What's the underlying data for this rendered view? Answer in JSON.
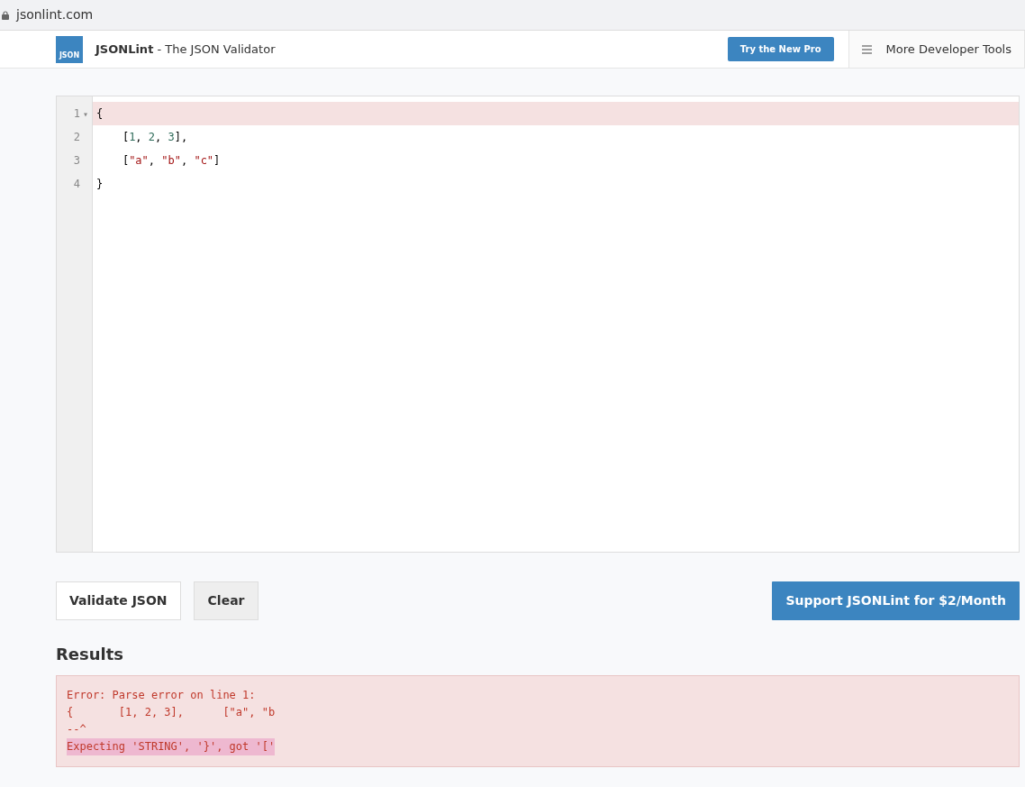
{
  "browser": {
    "address": "jsonlint.com"
  },
  "header": {
    "logo_text": "JSON",
    "brand": "JSONLint",
    "tagline": " - The JSON Validator",
    "pro_button": "Try the New Pro",
    "tools_menu": "More Developer Tools"
  },
  "editor": {
    "lines": [
      {
        "number": "1",
        "fold_marker": "▾",
        "error": true,
        "tokens": [
          {
            "kind": "punct",
            "text": "{"
          }
        ]
      },
      {
        "number": "2",
        "error": false,
        "tokens": [
          {
            "kind": "punct",
            "text": "    ["
          },
          {
            "kind": "number",
            "text": "1"
          },
          {
            "kind": "punct",
            "text": ", "
          },
          {
            "kind": "number",
            "text": "2"
          },
          {
            "kind": "punct",
            "text": ", "
          },
          {
            "kind": "number",
            "text": "3"
          },
          {
            "kind": "punct",
            "text": "],"
          }
        ]
      },
      {
        "number": "3",
        "error": false,
        "tokens": [
          {
            "kind": "punct",
            "text": "    ["
          },
          {
            "kind": "string",
            "text": "\"a\""
          },
          {
            "kind": "punct",
            "text": ", "
          },
          {
            "kind": "string",
            "text": "\"b\""
          },
          {
            "kind": "punct",
            "text": ", "
          },
          {
            "kind": "string",
            "text": "\"c\""
          },
          {
            "kind": "punct",
            "text": "]"
          }
        ]
      },
      {
        "number": "4",
        "error": false,
        "tokens": [
          {
            "kind": "punct",
            "text": "}"
          }
        ]
      }
    ]
  },
  "buttons": {
    "validate": "Validate JSON",
    "clear": "Clear",
    "support": "Support JSONLint for $2/Month"
  },
  "results": {
    "heading": "Results",
    "lines": [
      {
        "text": "Error: Parse error on line 1:",
        "highlighted": false
      },
      {
        "text": "{       [1, 2, 3],      [\"a\", \"b",
        "highlighted": false
      },
      {
        "text": "--^",
        "highlighted": false
      },
      {
        "text": "Expecting 'STRING', '}', got '['",
        "highlighted": true
      }
    ]
  }
}
